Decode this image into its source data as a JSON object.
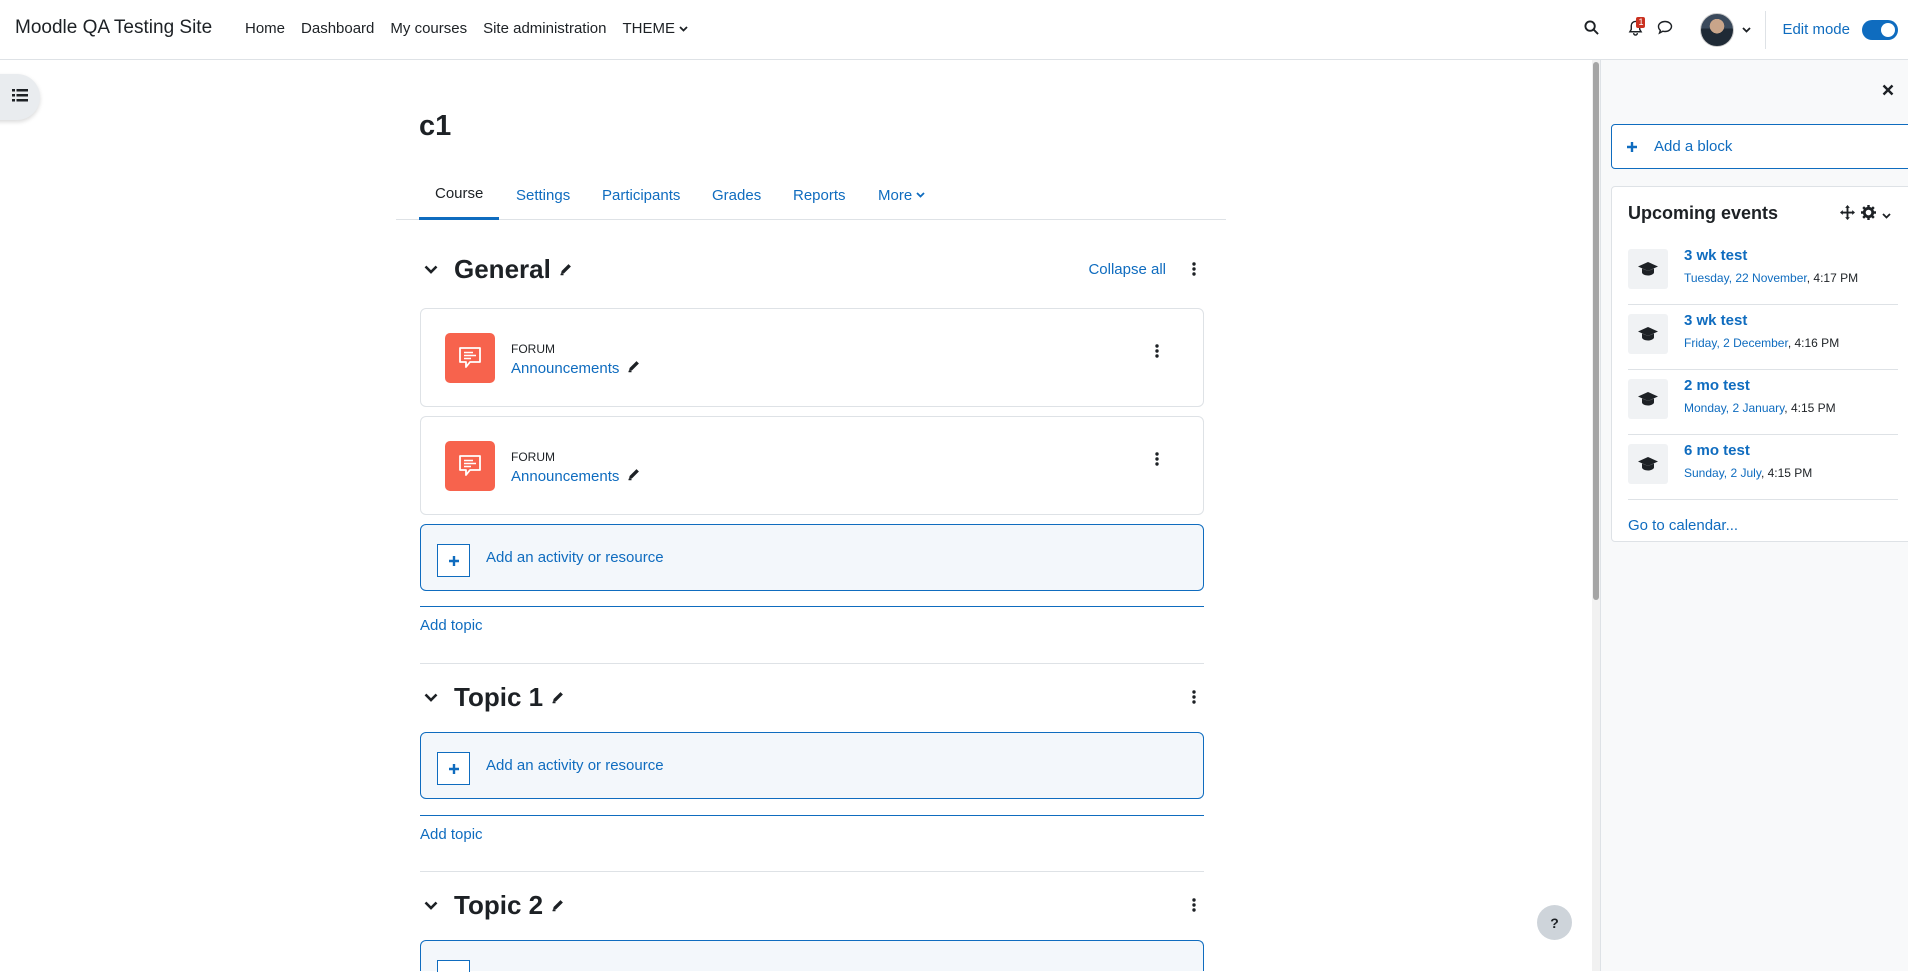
{
  "site": {
    "name": "Moodle QA Testing Site"
  },
  "primary_nav": {
    "home": "Home",
    "dashboard": "Dashboard",
    "my_courses": "My courses",
    "site_admin": "Site administration",
    "theme": "THEME"
  },
  "notifications": {
    "count": "1"
  },
  "edit_mode": {
    "label": "Edit mode",
    "enabled": true
  },
  "course": {
    "title": "c1",
    "tabs": [
      "Course",
      "Settings",
      "Participants",
      "Grades",
      "Reports",
      "More"
    ],
    "active_tab": "Course"
  },
  "sections": {
    "general": {
      "title": "General",
      "collapse_all": "Collapse all",
      "activities": [
        {
          "type": "FORUM",
          "name": "Announcements"
        },
        {
          "type": "FORUM",
          "name": "Announcements"
        }
      ]
    },
    "topic1": {
      "title": "Topic 1"
    },
    "topic2": {
      "title": "Topic 2"
    }
  },
  "actions": {
    "add_activity": "Add an activity or resource",
    "add_topic": "Add topic"
  },
  "help": {
    "label": "?"
  },
  "right_drawer": {
    "add_block": "Add a block",
    "upcoming_events": {
      "title": "Upcoming events",
      "events": [
        {
          "name": "3 wk test",
          "date_link": "Tuesday, 22 November",
          "time": ", 4:17 PM"
        },
        {
          "name": "3 wk test",
          "date_link": "Friday, 2 December",
          "time": ", 4:16 PM"
        },
        {
          "name": "2 mo test",
          "date_link": "Monday, 2 January",
          "time": ", 4:15 PM"
        },
        {
          "name": "6 mo test",
          "date_link": "Sunday, 2 July",
          "time": ", 4:15 PM"
        }
      ],
      "go_to_calendar": "Go to calendar..."
    }
  },
  "colors": {
    "accent": "#0f6cbf",
    "forum_icon_bg": "#f7634d",
    "notification_badge": "#ca3120"
  }
}
